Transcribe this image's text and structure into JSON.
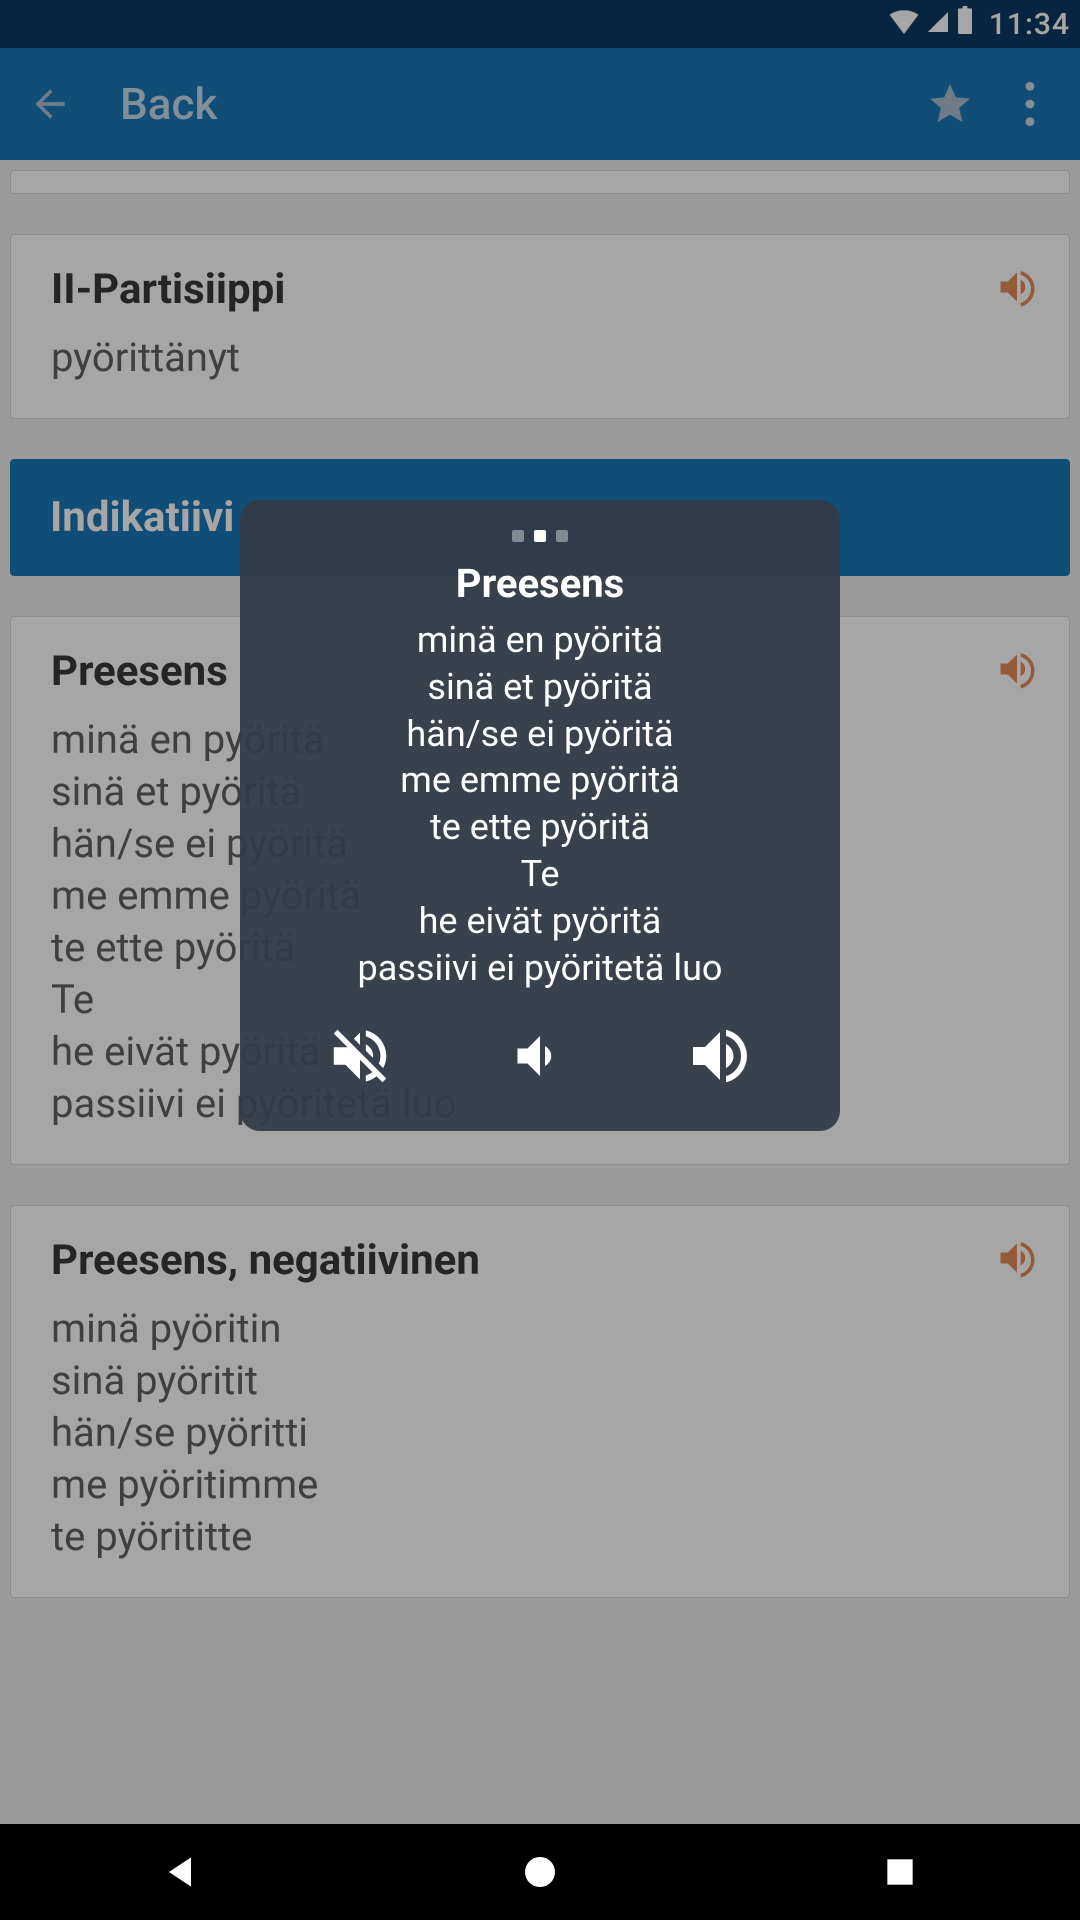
{
  "status": {
    "time": "11:34"
  },
  "appbar": {
    "title": "Back"
  },
  "cards": {
    "partisiippi": {
      "title": "II-Partisiippi",
      "line": "pyörittänyt"
    },
    "section_header": "Indikatiivi",
    "preesens": {
      "title": "Preesens",
      "lines": [
        "minä en pyöritä",
        "sinä et pyöritä",
        "hän/se ei pyöritä",
        "me emme pyöritä",
        "te ette pyöritä",
        "Te",
        "he eivät pyöritä",
        "passiivi ei pyöritetä luo"
      ]
    },
    "preesens_neg": {
      "title": "Preesens, negatiivinen",
      "lines": [
        "minä pyöritin",
        "sinä pyöritit",
        "hän/se pyöritti",
        "me pyöritimme",
        "te pyörititte"
      ]
    }
  },
  "popup": {
    "title": "Preesens",
    "lines": [
      "minä en pyöritä",
      "sinä et pyöritä",
      "hän/se ei pyöritä",
      "me emme pyöritä",
      "te ette pyöritä",
      "Te",
      "he eivät pyöritä",
      "passiivi ei pyöritetä luo"
    ]
  }
}
